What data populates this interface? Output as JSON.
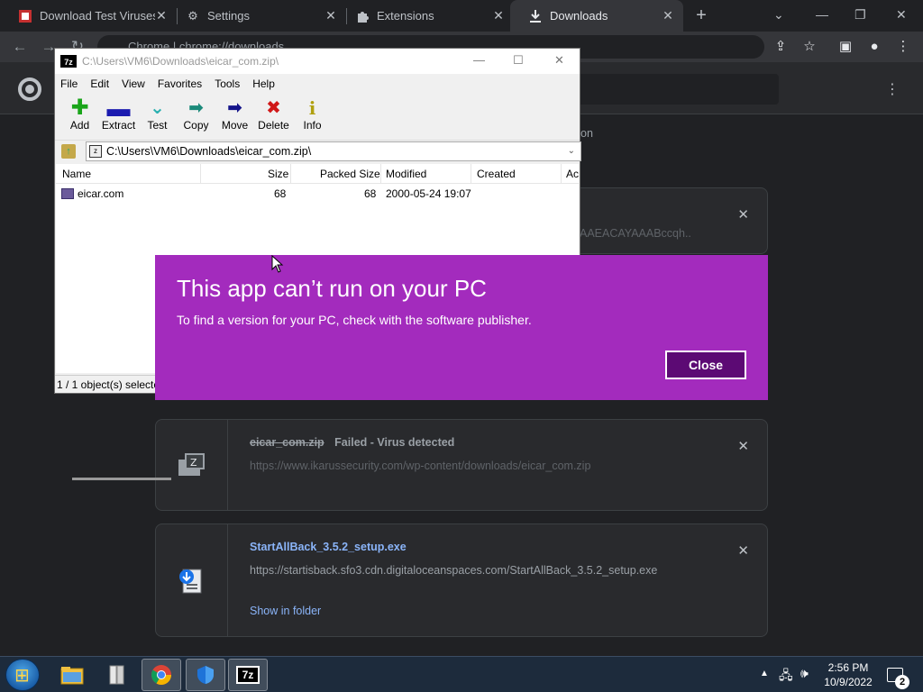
{
  "browser": {
    "tabs": [
      {
        "label": "Download Test Viruses",
        "icon": "virus-favicon"
      },
      {
        "label": "Settings",
        "icon": "gear-icon"
      },
      {
        "label": "Extensions",
        "icon": "puzzle-icon"
      },
      {
        "label": "Downloads",
        "icon": "download-icon"
      }
    ],
    "address": "Chrome | chrome://downloads"
  },
  "downloads": {
    "partial_url_1": "on",
    "partial_url_2": "AAEACAYAAABccqh..",
    "items": [
      {
        "name": "eicar_com.zip",
        "status": "Failed - Virus detected",
        "url": "https://www.ikarussecurity.com/wp-content/downloads/eicar_com.zip"
      },
      {
        "name": "StartAllBack_3.5.2_setup.exe",
        "url": "https://startisback.sfo3.cdn.digitaloceanspaces.com/StartAllBack_3.5.2_setup.exe",
        "action": "Show in folder"
      }
    ]
  },
  "zip_window": {
    "title": "C:\\Users\\VM6\\Downloads\\eicar_com.zip\\",
    "logo": "7z",
    "menu": [
      "File",
      "Edit",
      "View",
      "Favorites",
      "Tools",
      "Help"
    ],
    "tools": [
      {
        "label": "Add",
        "icon": "add-icon",
        "color": "#1aa51a"
      },
      {
        "label": "Extract",
        "icon": "extract-icon",
        "color": "#1b1bb0"
      },
      {
        "label": "Test",
        "icon": "test-icon",
        "color": "#2ab0b0"
      },
      {
        "label": "Copy",
        "icon": "copy-icon",
        "color": "#1b8a7a"
      },
      {
        "label": "Move",
        "icon": "move-icon",
        "color": "#14148a"
      },
      {
        "label": "Delete",
        "icon": "delete-icon",
        "color": "#d01818"
      },
      {
        "label": "Info",
        "icon": "info-icon",
        "color": "#b0a010"
      }
    ],
    "path": "C:\\Users\\VM6\\Downloads\\eicar_com.zip\\",
    "columns": [
      "Name",
      "Size",
      "Packed Size",
      "Modified",
      "Created",
      "Ac"
    ],
    "files": [
      {
        "name": "eicar.com",
        "size": "68",
        "packed": "68",
        "modified": "2000-05-24 19:07",
        "created": ""
      }
    ],
    "status": "1 / 1 object(s) selecte"
  },
  "dialog": {
    "title": "This app can’t run on your PC",
    "message": "To find a version for your PC, check with the software publisher.",
    "close_label": "Close",
    "background": "#a32bbd"
  },
  "taskbar": {
    "time": "2:56 PM",
    "date": "10/9/2022",
    "notification_count": "2",
    "zip_app_label": "7z"
  }
}
